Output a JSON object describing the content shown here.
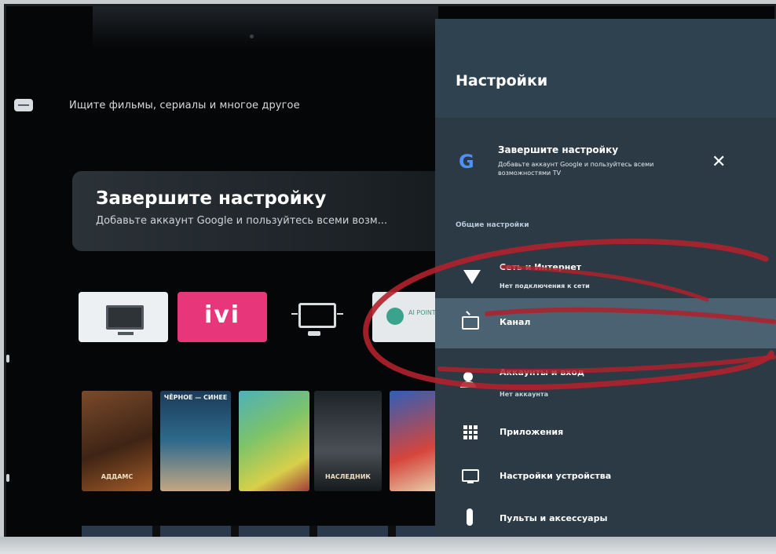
{
  "home": {
    "search_placeholder": "Ищите фильмы, сериалы и многое другое",
    "promo": {
      "title": "Завершите настройку",
      "subtitle": "Добавьте аккаунт Google и пользуйтесь всеми возм..."
    },
    "apps": [
      {
        "name": "tv-input-app-icon"
      },
      {
        "name": "ivi-app",
        "label": "ivi"
      },
      {
        "name": "screen-mirror-app-icon"
      },
      {
        "name": "app-tile",
        "label": "AI\nPOINT"
      }
    ],
    "posters": [
      {
        "top": "",
        "bottom": "АДДАМС"
      },
      {
        "top": "ЧЁРНОЕ — СИНЕЕ",
        "bottom": ""
      },
      {
        "top": "",
        "bottom": ""
      },
      {
        "top": "",
        "bottom": "НАСЛЕДНИК"
      },
      {
        "top": "",
        "bottom": ""
      }
    ]
  },
  "settings": {
    "title": "Настройки",
    "notice": {
      "icon": "google-g-icon",
      "title": "Завершите настройку",
      "text": "Добавьте аккаунт Google и пользуйтесь всеми возможностями TV",
      "close_icon": "close-icon"
    },
    "section_label": "Общие настройки",
    "items": [
      {
        "label": "Сеть и Интернет",
        "sub": "Нет подключения к сети",
        "icon": "wifi-icon"
      },
      {
        "label": "Канал",
        "sub": "",
        "icon": "tv-icon"
      },
      {
        "label": "Аккаунты и вход",
        "sub": "Нет аккаунта",
        "icon": "add-account-icon"
      },
      {
        "label": "Приложения",
        "sub": "",
        "icon": "apps-grid-icon"
      },
      {
        "label": "Настройки устройства",
        "sub": "",
        "icon": "monitor-icon"
      },
      {
        "label": "Пульты и аксессуары",
        "sub": "",
        "icon": "remote-icon"
      }
    ],
    "selected_index": 1
  },
  "colors": {
    "panel_bg": "#2b3a45",
    "panel_header_bg": "#2f4250",
    "selected_item_bg": "#4b6273",
    "ivi_pink": "#e8367a",
    "annotation_red": "#b0212b"
  }
}
